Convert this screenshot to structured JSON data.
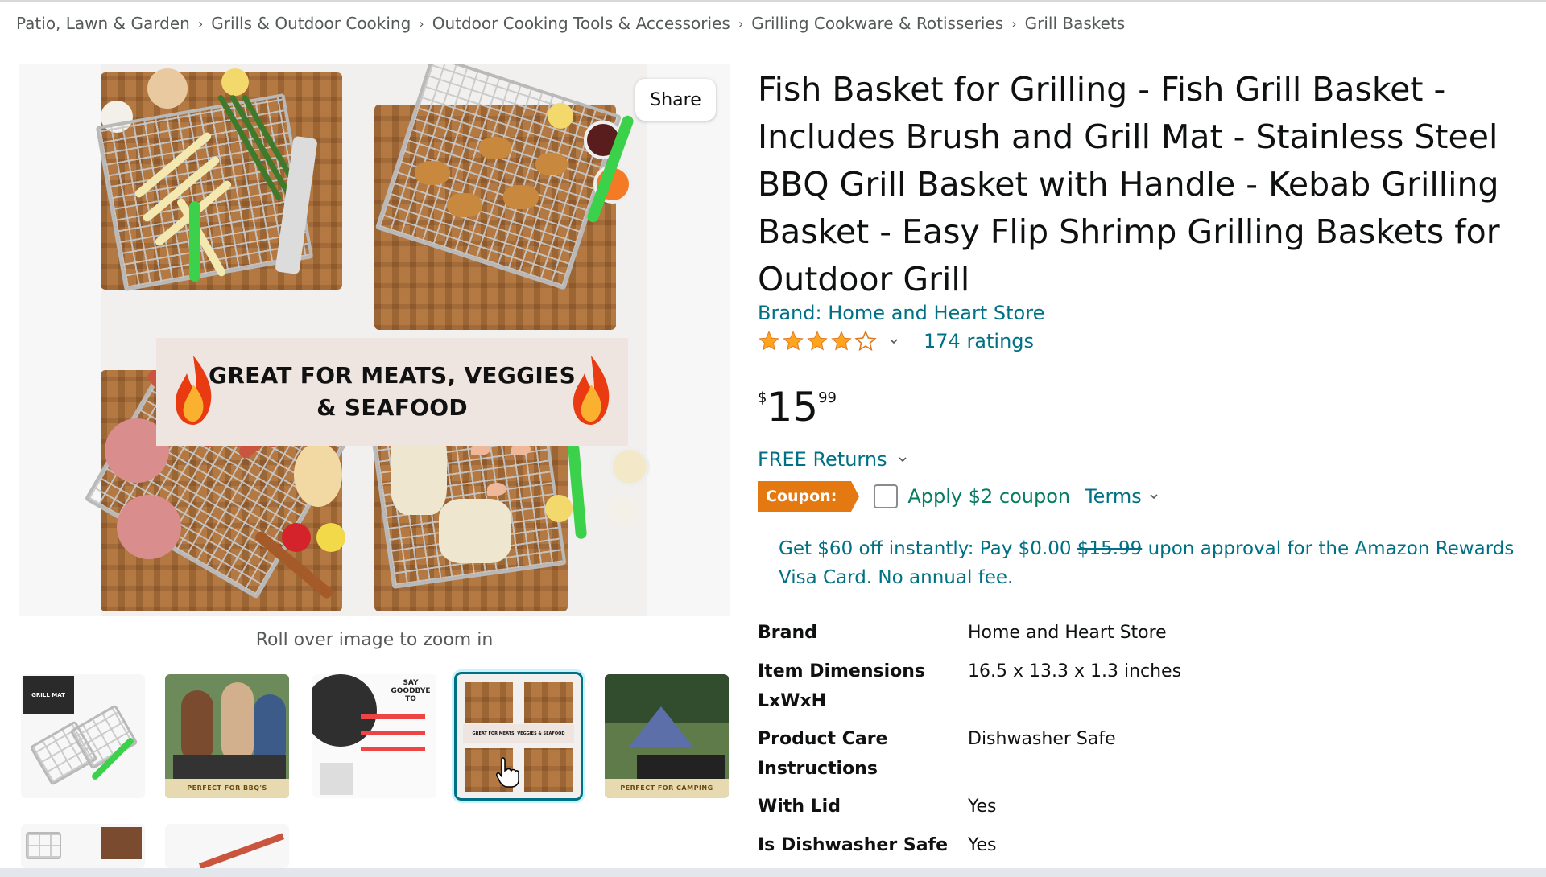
{
  "breadcrumb": [
    "Patio, Lawn & Garden",
    "Grills & Outdoor Cooking",
    "Outdoor Cooking Tools & Accessories",
    "Grilling Cookware & Rotisseries",
    "Grill Baskets"
  ],
  "breadcrumb_separator_icon": "chevron-right-icon",
  "gallery": {
    "banner_text_line1": "GREAT FOR MEATS, VEGGIES",
    "banner_text_line2": "& SEAFOOD",
    "share_label": "Share",
    "zoom_hint": "Roll over image to zoom in",
    "thumbnails": [
      {
        "label": "GRILL MAT",
        "caption": ""
      },
      {
        "label": "",
        "caption": "PERFECT FOR BBQ'S"
      },
      {
        "label": "SAY GOODBYE TO",
        "caption": ""
      },
      {
        "label": "GREAT FOR MEATS, VEGGIES & SEAFOOD",
        "caption": "",
        "selected": true
      },
      {
        "label": "",
        "caption": "PERFECT FOR CAMPING"
      }
    ]
  },
  "product": {
    "title": "Fish Basket for Grilling - Fish Grill Basket - Includes Brush and Grill Mat - Stainless Steel BBQ Grill Basket with Handle - Kebab Grilling Basket - Easy Flip Shrimp Grilling Baskets for Outdoor Grill",
    "brand_link": "Brand: Home and Heart Store",
    "rating": 4.0,
    "ratings_count": "174 ratings",
    "price": {
      "symbol": "$",
      "whole": "15",
      "fraction": "99"
    },
    "free_returns": "FREE Returns",
    "coupon": {
      "badge": "Coupon:",
      "label": "Apply $2 coupon",
      "terms": "Terms",
      "checked": false
    },
    "promo": {
      "prefix": "Get $60 off instantly: Pay $0.00 ",
      "strike": "$15.99",
      "suffix": " upon approval for the Amazon Rewards Visa Card. No annual fee."
    },
    "specs": [
      {
        "key": "Brand",
        "value": "Home and Heart Store"
      },
      {
        "key": "Item Dimensions LxWxH",
        "value": "16.5 x 13.3 x 1.3 inches"
      },
      {
        "key": "Product Care Instructions",
        "value": "Dishwasher Safe"
      },
      {
        "key": "With Lid",
        "value": "Yes"
      },
      {
        "key": "Is Dishwasher Safe",
        "value": "Yes"
      }
    ]
  },
  "colors": {
    "link": "#007185",
    "coupon_badge": "#e47911",
    "coupon_text": "#067d62",
    "star": "#ffa41c",
    "selected_thumb_border": "#007185"
  }
}
